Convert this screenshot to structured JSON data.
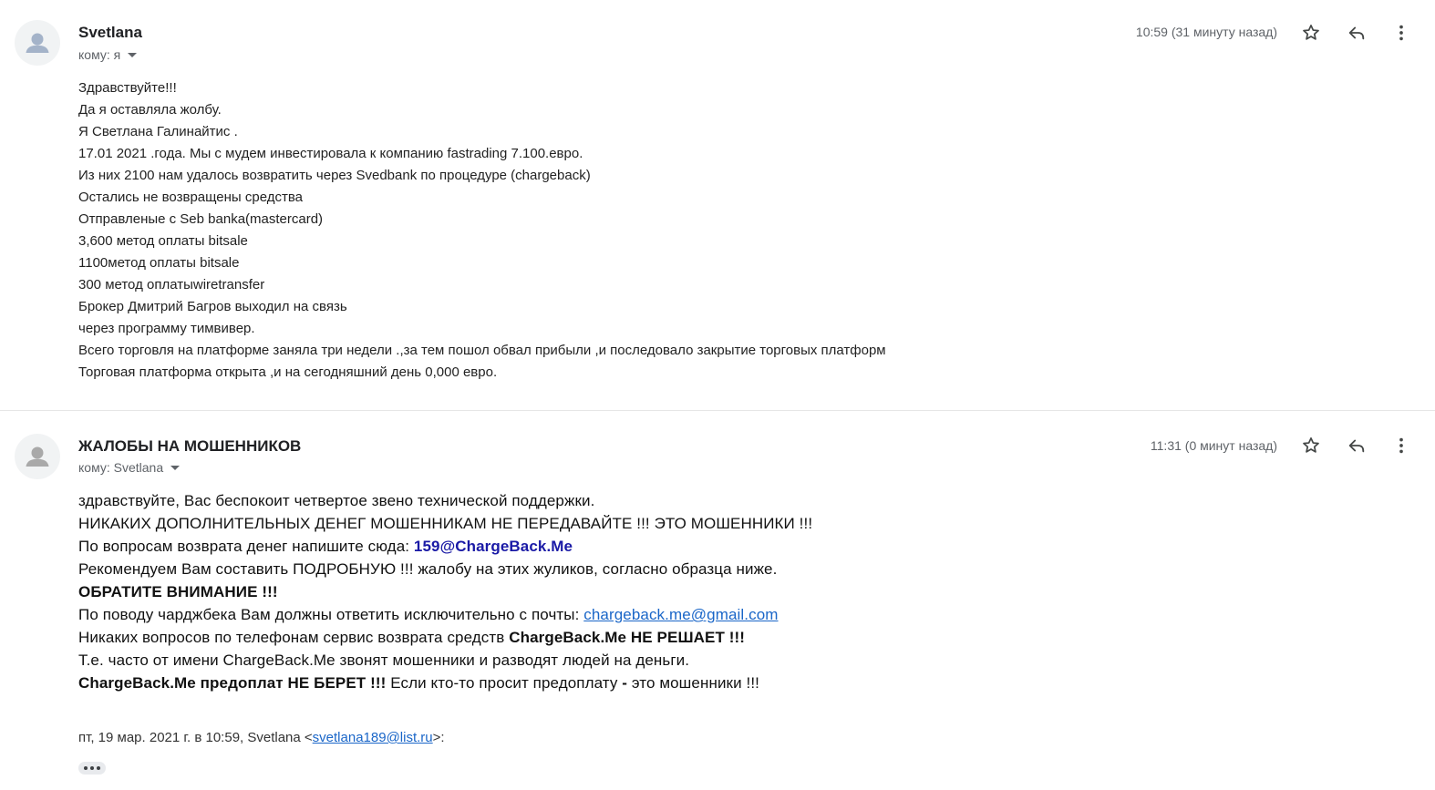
{
  "messages": [
    {
      "sender": "Svetlana",
      "to_line": "кому: я",
      "time": "10:59 (31 минуту назад)",
      "body_lines": [
        "Здравствуйте!!!",
        "Да я оставляла жолбу.",
        "Я Светлана Галинайтис .",
        "17.01 2021 .года. Мы с мудем инвестировала к компанию fastrading 7.100.евро.",
        "Из них 2100  нам удалось возвратить через Svedbank по процедуре (chargeback)",
        "Остались не возвращены средства",
        "Отправленые с Seb banka(mastercard)",
        "3,600 метод оплаты bitsale",
        "1100метод оплаты bitsale",
        "300 метод оплатыwiretransfer",
        "Брокер  Дмитрий Багров выходил на связь",
        "через программу тимвивер.",
        "Всего торговля на платформе заняла три недели .,за тем пошол обвал прибыли ,и последовало закрытие торговых платформ",
        "Торговая платформа открыта ,и на сегодняшний день 0,000 евро."
      ]
    },
    {
      "sender": "ЖАЛОБЫ НА МОШЕННИКОВ",
      "to_line": "кому: Svetlana",
      "time": "11:31 (0 минут назад)",
      "body": {
        "l1": "здравствуйте, Вас беспокоит четвертое звено технической поддержки.",
        "l2": "НИКАКИХ ДОПОЛНИТЕЛЬНЫХ ДЕНЕГ МОШЕННИКАМ НЕ ПЕРЕДАВАЙТЕ !!! ЭТО МОШЕННИКИ !!!",
        "l3_text": "По вопросам возврата денег напишите сюда: ",
        "l3_email": "159@ChargeBack.Me",
        "l4": "Рекомендуем Вам составить ПОДРОБНУЮ !!! жалобу на этих жуликов, согласно образца ниже.",
        "l5": "ОБРАТИТЕ ВНИМАНИЕ !!!",
        "l6_text": "По поводу чарджбека Вам должны ответить исключительно с почты: ",
        "l6_email": "chargeback.me@gmail.com",
        "l7_text": "Никаких вопросов по телефонам сервис возврата средств ",
        "l7_bold": "ChargeBack.Me НЕ РЕШАЕТ !!!",
        "l8": "Т.е. часто от имени ChargeBack.Me звонят мошенники и разводят людей на деньги.",
        "l9_bold": "ChargeBack.Me предоплат НЕ БЕРЕТ !!!",
        "l9_text": " Если кто-то просит предоплату ",
        "l9_dash": "-",
        "l9_end": " это мошенники !!!"
      },
      "quote": {
        "prefix": "пт, 19 мар. 2021 г. в 10:59, Svetlana <",
        "email": "svetlana189@list.ru",
        "suffix": ">:"
      }
    }
  ],
  "icons": [
    "avatar-icon",
    "star-icon",
    "reply-icon",
    "more-vert-icon",
    "caret-down-icon",
    "ellipsis-icon"
  ],
  "colors": {
    "accent_link": "#1a66c8",
    "email_bold": "#1a1aa6",
    "meta_gray": "#5f6368"
  }
}
